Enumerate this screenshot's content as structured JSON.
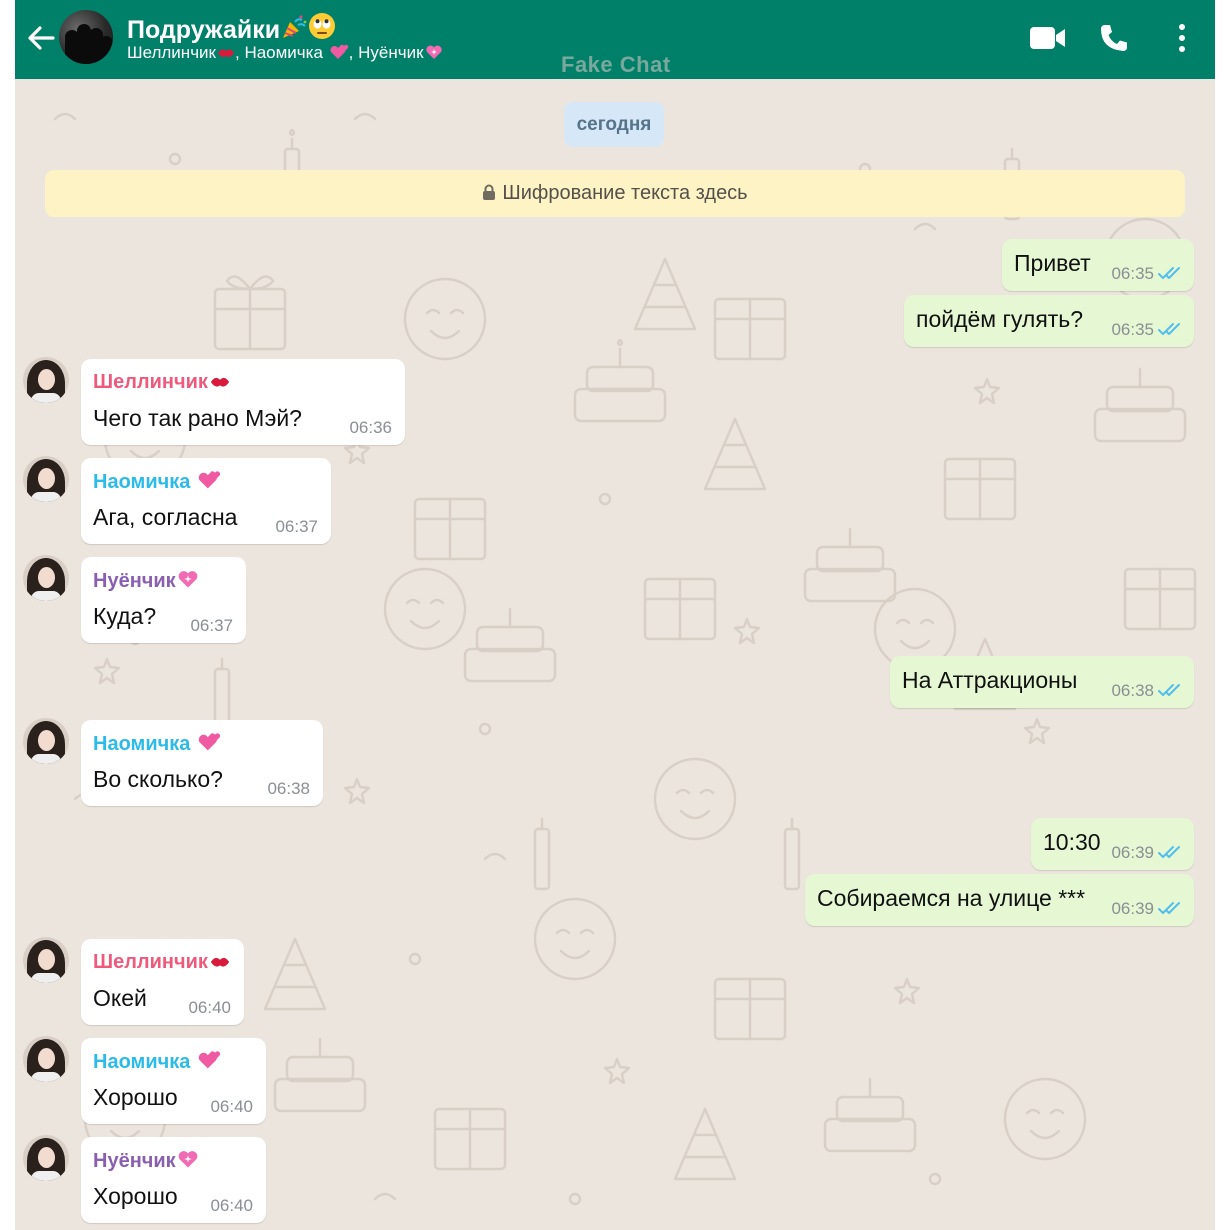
{
  "header": {
    "title": "Подружайки",
    "title_emojis": [
      "party-popper",
      "eye-roll-face"
    ],
    "members": [
      {
        "name": "Шеллинчик",
        "emoji": "kiss-mark"
      },
      {
        "name": "Наомичка",
        "emoji": "two-hearts"
      },
      {
        "name": "Нуёнчик",
        "emoji": "sparkling-heart"
      }
    ],
    "icons": [
      "back-arrow-icon",
      "video-call-icon",
      "phone-icon",
      "more-options-icon"
    ]
  },
  "watermark": "Fake Chat",
  "date_chip": "сегодня",
  "encryption_notice": "Шифрование текста здесь",
  "colors": {
    "header": "#008069",
    "chat_bg": "#ece5dd",
    "outgoing_bubble": "#e5f8d3",
    "incoming_bubble": "#ffffff",
    "read_ticks": "#53bdeb"
  },
  "senders": {
    "shellinchik": {
      "name": "Шеллинчик",
      "color": "#ef5a7c"
    },
    "naomichka": {
      "name": "Наомичка",
      "color": "#2bbbe8"
    },
    "nuyonchik": {
      "name": "Нуёнчик",
      "color": "#8a5fb0"
    }
  },
  "messages": [
    {
      "dir": "out",
      "text": "Привет",
      "time": "06:35",
      "status": "read"
    },
    {
      "dir": "out",
      "text": "пойдём гулять?",
      "time": "06:35",
      "status": "read"
    },
    {
      "dir": "in",
      "sender": "shellinchik",
      "text": "Чего так рано Мэй?",
      "time": "06:36"
    },
    {
      "dir": "in",
      "sender": "naomichka",
      "text": "Ага, согласна",
      "time": "06:37"
    },
    {
      "dir": "in",
      "sender": "nuyonchik",
      "text": "Куда?",
      "time": "06:37"
    },
    {
      "dir": "out",
      "text": "На Аттракционы",
      "time": "06:38",
      "status": "read"
    },
    {
      "dir": "in",
      "sender": "naomichka",
      "text": "Во сколько?",
      "time": "06:38"
    },
    {
      "dir": "out",
      "text": "10:30",
      "time": "06:39",
      "status": "read"
    },
    {
      "dir": "out",
      "text": "Собираемся на улице ***",
      "time": "06:39",
      "status": "read"
    },
    {
      "dir": "in",
      "sender": "shellinchik",
      "text": "Окей",
      "time": "06:40"
    },
    {
      "dir": "in",
      "sender": "naomichka",
      "text": "Хорошо",
      "time": "06:40"
    },
    {
      "dir": "in",
      "sender": "nuyonchik",
      "text": "Хорошо",
      "time": "06:40"
    }
  ]
}
